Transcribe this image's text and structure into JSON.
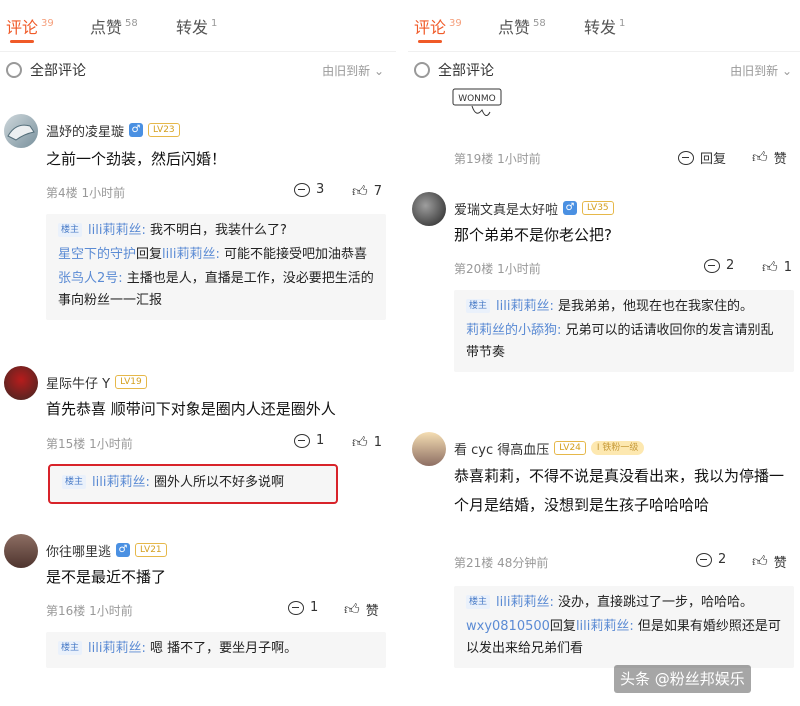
{
  "tabs": [
    {
      "label": "评论",
      "count": "39"
    },
    {
      "label": "点赞",
      "count": "58"
    },
    {
      "label": "转发",
      "count": "1"
    }
  ],
  "sortbar": {
    "title": "全部评论",
    "sort": "由旧到新"
  },
  "left": {
    "comments": [
      {
        "username": "温妤的凌星璇",
        "level": "LV23",
        "text": "之前一个劲装，然后闪婚！",
        "floor": "第4楼",
        "time": "1小时前",
        "reply_count": "3",
        "like_count": "7",
        "replies": [
          {
            "owner": "楼主",
            "name": "lili莉莉丝:",
            "text": " 我不明白，我装什么了?"
          },
          {
            "name": "星空下的守护",
            "mid": "回复",
            "name2": "lili莉莉丝:",
            "text": " 可能不能接受吧加油恭喜"
          },
          {
            "name": "张鸟人2号:",
            "text": " 主播也是人，直播是工作，没必要把生活的事向粉丝一一汇报"
          }
        ]
      },
      {
        "username": "星际牛仔 Y",
        "level": "LV19",
        "text": "首先恭喜 顺带问下对象是圈内人还是圈外人",
        "floor": "第15楼",
        "time": "1小时前",
        "reply_count": "1",
        "like_count": "1",
        "replies": [
          {
            "owner": "楼主",
            "name": "lili莉莉丝:",
            "text": " 圈外人所以不好多说啊"
          }
        ]
      },
      {
        "username": "你往哪里逃",
        "level": "LV21",
        "text": "是不是最近不播了",
        "floor": "第16楼",
        "time": "1小时前",
        "reply_count": "1",
        "like_count": "赞",
        "replies": [
          {
            "owner": "楼主",
            "name": "lili莉莉丝:",
            "text": " 嗯 播不了，要坐月子啊。"
          }
        ]
      }
    ]
  },
  "right": {
    "top_meta": {
      "floor": "第19楼",
      "time": "1小时前",
      "reply_label": "回复",
      "like_label": "赞"
    },
    "sticker_text": "WONMO",
    "comments": [
      {
        "username": "爱瑞文真是太好啦",
        "level": "LV35",
        "text": "那个弟弟不是你老公把?",
        "floor": "第20楼",
        "time": "1小时前",
        "reply_count": "2",
        "like_count": "1",
        "replies": [
          {
            "owner": "楼主",
            "name": "lili莉莉丝:",
            "text": " 是我弟弟，他现在也在我家住的。"
          },
          {
            "name": "莉莉丝的小舔狗:",
            "text": " 兄弟可以的话请收回你的发言请别乱带节奏"
          }
        ]
      },
      {
        "username": "看 cyc 得高血压",
        "level": "LV24",
        "badge": "I 铁粉一级",
        "text": "恭喜莉莉，不得不说是真没看出来，我以为停播一个月是结婚，没想到是生孩子哈哈哈哈",
        "floor": "第21楼",
        "time": "48分钟前",
        "reply_count": "2",
        "like_count": "赞",
        "replies": [
          {
            "owner": "楼主",
            "name": "lili莉莉丝:",
            "text": " 没办，直接跳过了一步，哈哈哈。"
          },
          {
            "name": "wxy0810500",
            "mid": "回复",
            "name2": "lili莉莉丝:",
            "text": " 但是如果有婚纱照还是可以发出来给兄弟们看"
          }
        ]
      }
    ]
  },
  "watermark": "头条 @粉丝邦娱乐",
  "colors": {
    "accent": "#f05a28",
    "link": "#5b8bd4",
    "highlight": "#d8232a"
  }
}
